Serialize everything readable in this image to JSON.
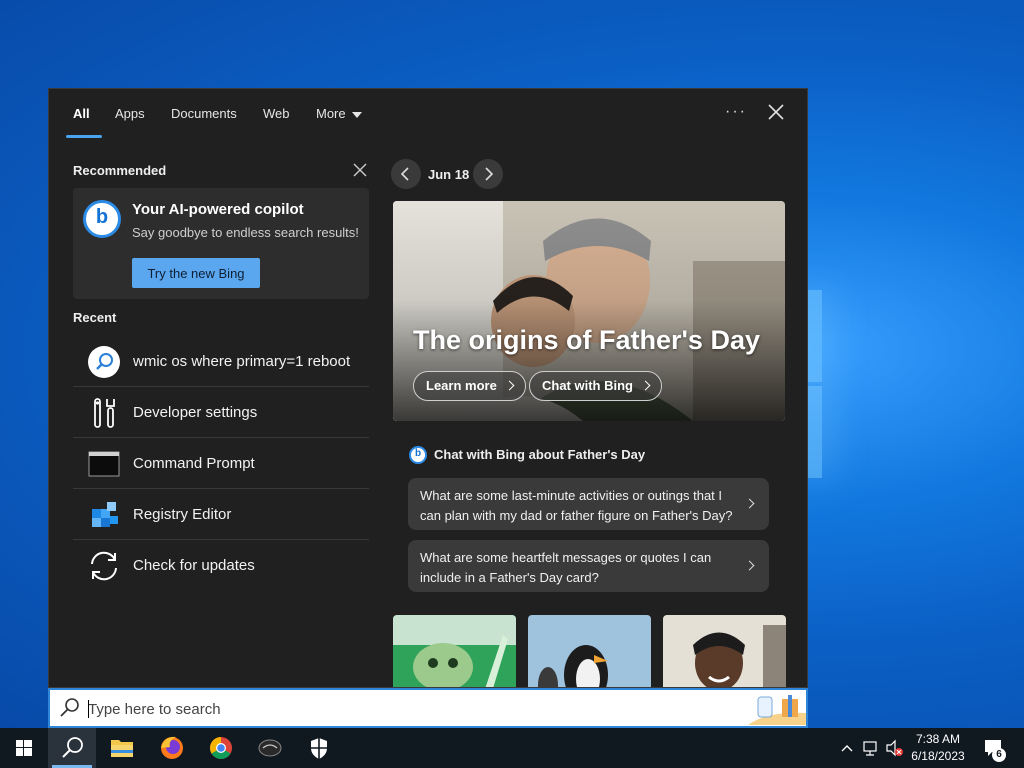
{
  "tabs": [
    {
      "label": "All",
      "active": true
    },
    {
      "label": "Apps"
    },
    {
      "label": "Documents"
    },
    {
      "label": "Web"
    },
    {
      "label": "More"
    }
  ],
  "header": {
    "more_options_icon": "ellipsis-icon",
    "close_icon": "close-icon"
  },
  "recommended": {
    "title": "Recommended",
    "card": {
      "title": "Your AI-powered copilot",
      "subtitle": "Say goodbye to endless search results!",
      "button_label": "Try the new Bing",
      "logo_letter": "b"
    }
  },
  "recent": {
    "title": "Recent",
    "items": [
      {
        "label": "wmic os where primary=1 reboot",
        "icon": "search-icon"
      },
      {
        "label": "Developer settings",
        "icon": "developer-tools-icon"
      },
      {
        "label": "Command Prompt",
        "icon": "command-prompt-icon"
      },
      {
        "label": "Registry Editor",
        "icon": "registry-editor-icon"
      },
      {
        "label": "Check for updates",
        "icon": "sync-icon"
      }
    ]
  },
  "news": {
    "date": "Jun 18",
    "hero_title": "The origins of Father's Day",
    "learn_more": "Learn more",
    "chat_with_bing": "Chat with Bing",
    "chat_heading": "Chat with Bing about Father's Day",
    "chat_logo_letter": "b",
    "suggestions": [
      "What are some last-minute activities or outings that I can plan with my dad or father figure on Father's Day?",
      "What are some heartfelt messages or quotes I can include in a Father's Day card?"
    ]
  },
  "search": {
    "placeholder": "Type here to search"
  },
  "taskbar": {
    "time": "7:38 AM",
    "date": "6/18/2023",
    "notification_count": "6",
    "apps": [
      "windows-start-icon",
      "search-icon",
      "file-explorer-icon",
      "firefox-icon",
      "chrome-icon",
      "app-icon",
      "security-shield-icon"
    ]
  },
  "colors": {
    "accent": "#4aa3f0",
    "panel_bg": "#202020",
    "button_blue": "#5aa7ef"
  }
}
